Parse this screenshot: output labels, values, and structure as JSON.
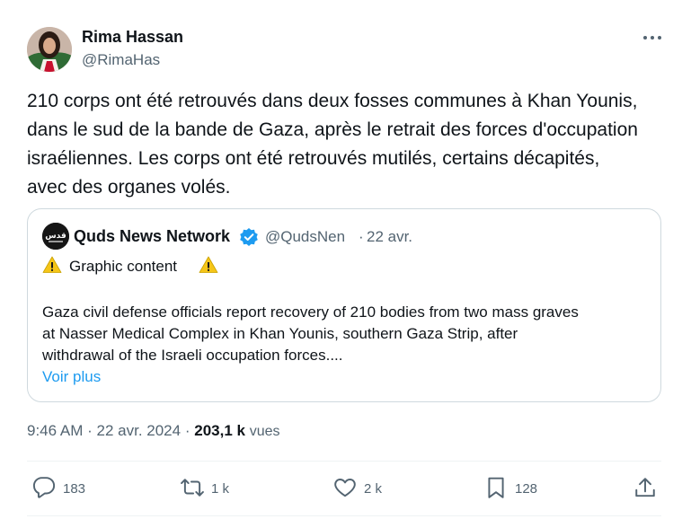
{
  "author": {
    "name": "Rima Hassan",
    "handle": "@RimaHas"
  },
  "tweet_text": "210 corps ont été retrouvés dans deux fosses communes à Khan Younis,\ndans le sud de la bande de Gaza, après le retrait des forces d'occupation\nisraéliennes. Les corps ont été retrouvés mutilés, certains décapités,\navec des organes volés.",
  "quote": {
    "name": "Quds News Network",
    "handle": "@QudsNen",
    "separator": "·",
    "date": "22 avr.",
    "warning": "Graphic content",
    "text": "Gaza civil defense officials report recovery of 210 bodies from two mass graves\nat Nasser Medical Complex in Khan Younis, southern Gaza Strip, after\nwithdrawal of the Israeli occupation forces....",
    "show_more": "Voir plus"
  },
  "meta": {
    "time": "9:46 AM",
    "date": "22 avr. 2024",
    "separator": "·",
    "views_count": "203,1 k",
    "views_label": "vues"
  },
  "actions": {
    "replies": "183",
    "reposts": "1 k",
    "likes": "2 k",
    "bookmarks": "128"
  },
  "icons": {
    "more": "more-horizontal-icon",
    "verified": "verified-badge-icon",
    "warning": "warning-icon",
    "reply": "reply-icon",
    "repost": "repost-icon",
    "like": "heart-icon",
    "bookmark": "bookmark-icon",
    "share": "share-icon"
  },
  "colors": {
    "text": "#0f1419",
    "secondary": "#536471",
    "link": "#1d9bf0",
    "border": "#cfd9de",
    "verified": "#1d9bf0"
  }
}
